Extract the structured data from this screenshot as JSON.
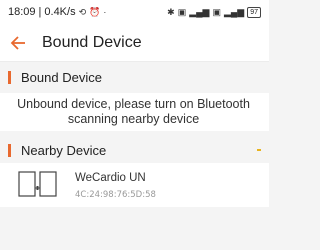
{
  "status_bar": {
    "time": "18:09",
    "speed": "0.4K/s",
    "battery": "97"
  },
  "navbar": {
    "title": "Bound Device"
  },
  "bound_section": {
    "title": "Bound Device",
    "message": "Unbound device, please turn on Bluetooth scanning nearby device"
  },
  "nearby_section": {
    "title": "Nearby Device"
  },
  "devices": [
    {
      "name": "WeCardio UN",
      "mac": "4C:24:98:76:5D:58"
    }
  ],
  "colors": {
    "accent": "#e8692f",
    "background": "#f4f4f4",
    "spinner": "#e8b31f"
  }
}
